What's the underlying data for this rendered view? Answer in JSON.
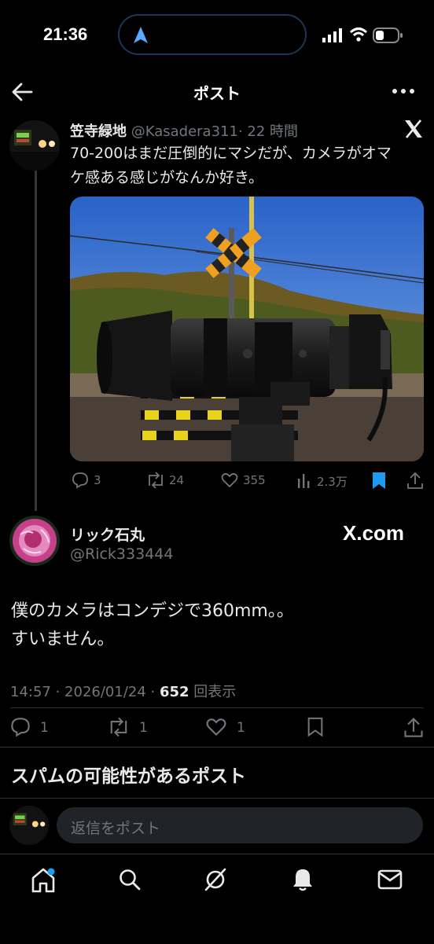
{
  "status_bar": {
    "time": "21:36"
  },
  "header": {
    "title": "ポスト"
  },
  "quoted_post": {
    "author_name": "笠寺緑地",
    "author_handle": "@Kasadera311",
    "time_ago": "· 22 時間",
    "text_line1": "70-200はまだ圧倒的にマシだが、カメラがオマ",
    "text_line2": "ケ感ある感じがなんか好き。",
    "stats": {
      "replies": "3",
      "reposts": "24",
      "likes": "355",
      "views": "2.3万"
    },
    "x_logo": "X"
  },
  "main_post": {
    "author_name": "リック石丸",
    "author_handle": "@Rick333444",
    "badge": "X.com",
    "text_line1": "僕のカメラはコンデジで360mm。。",
    "text_line2": "すいません。",
    "timestamp": "14:57 · 2026/01/24 · ",
    "views_count": "652",
    "views_label": " 回表示",
    "stats": {
      "replies": "1",
      "reposts": "1",
      "likes": "1"
    }
  },
  "spam_section": {
    "title": "スパムの可能性があるポスト"
  },
  "reply_bar": {
    "placeholder": "返信をポスト"
  },
  "colors": {
    "accent": "#1d9bf0",
    "background": "#000000",
    "muted": "#71767b",
    "text": "#e7e9ea"
  }
}
